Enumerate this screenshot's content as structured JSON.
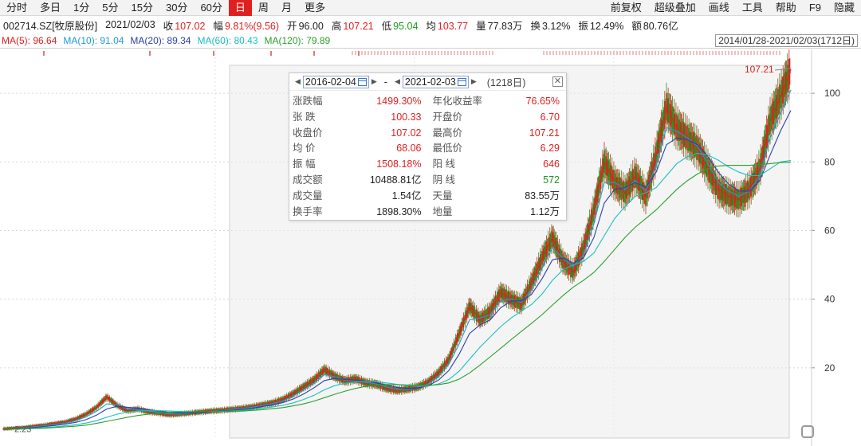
{
  "toolbar": {
    "left": [
      "分时",
      "多日",
      "1分",
      "5分",
      "15分",
      "30分",
      "60分",
      "日",
      "周",
      "月",
      "更多"
    ],
    "active_index": 7,
    "right": [
      "前复权",
      "超级叠加",
      "画线",
      "工具",
      "帮助",
      "F9",
      "隐藏"
    ]
  },
  "quote": {
    "code": "002714.SZ[牧原股份]",
    "date": "2021/02/03",
    "close_label": "收",
    "close": "107.02",
    "range_label": "幅",
    "range": "9.81%(9.56)",
    "open_label": "开",
    "open": "96.00",
    "high_label": "高",
    "high": "107.21",
    "low_label": "低",
    "low": "95.04",
    "avg_label": "均",
    "avg": "103.77",
    "vol_label": "量",
    "vol": "77.83万",
    "turnover_label": "换",
    "turnover": "3.12%",
    "amp_label": "振",
    "amp": "12.49%",
    "amount_label": "额",
    "amount": "80.76亿"
  },
  "ma": [
    {
      "label": "MA(5): 96.64",
      "color": "#e02020"
    },
    {
      "label": "MA(10): 91.04",
      "color": "#1e9bd8"
    },
    {
      "label": "MA(20): 89.34",
      "color": "#2a3fb0"
    },
    {
      "label": "MA(60): 80.43",
      "color": "#17c0c0"
    },
    {
      "label": "MA(120): 79.89",
      "color": "#2aa02a"
    }
  ],
  "range_text": "2014/01/28-2021/02/03(1712日)",
  "popup": {
    "start_date": "2016-02-04",
    "end_date": "2021-02-03",
    "days": "(1218日)",
    "rows": [
      {
        "label": "涨跌幅",
        "value": "1499.30%",
        "color": "#e02020"
      },
      {
        "label": "年化收益率",
        "value": "76.65%",
        "color": "#e02020"
      },
      {
        "label": "张 跌",
        "value": "100.33",
        "color": "#e02020"
      },
      {
        "label": "开盘价",
        "value": "6.70",
        "color": "#e02020"
      },
      {
        "label": "收盘价",
        "value": "107.02",
        "color": "#e02020"
      },
      {
        "label": "最高价",
        "value": "107.21",
        "color": "#e02020"
      },
      {
        "label": "均 价",
        "value": "68.06",
        "color": "#e02020"
      },
      {
        "label": "最低价",
        "value": "6.29",
        "color": "#e02020"
      },
      {
        "label": "振 幅",
        "value": "1508.18%",
        "color": "#e02020"
      },
      {
        "label": "阳 线",
        "value": "646",
        "color": "#e02020"
      },
      {
        "label": "成交额",
        "value": "10488.81亿",
        "color": "#222222"
      },
      {
        "label": "阴 线",
        "value": "572",
        "color": "#1a9a1a"
      },
      {
        "label": "成交量",
        "value": "1.54亿",
        "color": "#222222"
      },
      {
        "label": "天量",
        "value": "83.55万",
        "color": "#222222"
      },
      {
        "label": "换手率",
        "value": "1898.30%",
        "color": "#222222"
      },
      {
        "label": "地量",
        "value": "1.12万",
        "color": "#222222"
      }
    ]
  },
  "chart_data": {
    "type": "line",
    "y_ticks": [
      20,
      40,
      60,
      80,
      100
    ],
    "ylim": [
      0,
      110
    ],
    "max_label": "107.21",
    "min_label": "2.23",
    "series": [
      {
        "values": [
          2.2,
          2.4,
          2.6,
          3.0,
          3.3,
          3.8,
          4.2,
          5.1,
          6.5,
          8.5,
          11.5,
          9.0,
          7.5,
          8.0,
          7.2,
          6.8,
          6.3,
          6.5,
          6.8,
          7.1,
          7.4,
          7.6,
          7.9,
          8.2,
          8.6,
          9.2,
          9.8,
          10.8,
          12.5,
          14.5,
          16.5,
          19.5,
          17.5,
          16.2,
          16.8,
          15.6,
          15.2,
          14.0,
          13.4,
          13.8,
          14.4,
          15.8,
          18.5,
          22.5,
          30.0,
          38.0,
          34.0,
          36.5,
          42.0,
          40.0,
          38.5,
          45.0,
          52.0,
          58.0,
          51.0,
          48.0,
          55.0,
          66.0,
          80.0,
          74.0,
          71.0,
          76.0,
          70.0,
          82.0,
          96.0,
          90.0,
          87.0,
          84.0,
          78.0,
          72.0,
          70.0,
          69.0,
          72.0,
          78.0,
          92.0,
          99.0,
          107.0
        ]
      },
      {
        "values": [
          2.2,
          2.3,
          2.5,
          2.8,
          3.1,
          3.5,
          3.9,
          4.6,
          5.7,
          7.3,
          9.5,
          9.2,
          8.1,
          7.9,
          7.4,
          7.0,
          6.6,
          6.5,
          6.7,
          7.0,
          7.3,
          7.5,
          7.8,
          8.1,
          8.5,
          9.0,
          9.6,
          10.4,
          11.8,
          13.6,
          15.5,
          18.0,
          17.4,
          16.4,
          16.4,
          15.8,
          15.3,
          14.4,
          13.7,
          13.7,
          14.2,
          15.3,
          17.5,
          21.0,
          27.0,
          34.0,
          34.5,
          35.5,
          39.5,
          40.0,
          39.0,
          43.0,
          49.0,
          55.0,
          52.0,
          49.5,
          53.0,
          62.0,
          74.0,
          74.0,
          72.0,
          74.5,
          71.5,
          79.0,
          90.0,
          89.0,
          87.0,
          84.5,
          79.5,
          74.0,
          71.5,
          70.0,
          71.5,
          76.0,
          87.0,
          94.0,
          101.0
        ]
      },
      {
        "values": [
          2.2,
          2.3,
          2.4,
          2.6,
          2.9,
          3.2,
          3.6,
          4.1,
          4.9,
          6.2,
          8.0,
          8.8,
          8.5,
          8.2,
          7.8,
          7.4,
          7.0,
          6.8,
          6.8,
          6.9,
          7.1,
          7.4,
          7.6,
          7.9,
          8.2,
          8.7,
          9.2,
          9.9,
          10.9,
          12.4,
          14.2,
          16.3,
          16.9,
          16.6,
          16.4,
          16.1,
          15.6,
          15.0,
          14.3,
          14.0,
          14.1,
          14.8,
          16.4,
          19.2,
          24.0,
          30.0,
          32.5,
          34.0,
          37.5,
          39.5,
          39.5,
          41.5,
          46.0,
          51.5,
          52.0,
          50.5,
          52.0,
          58.0,
          68.0,
          72.0,
          72.5,
          74.0,
          72.5,
          77.0,
          85.0,
          87.0,
          86.5,
          85.0,
          81.5,
          77.0,
          73.5,
          71.5,
          71.5,
          74.5,
          82.0,
          89.0,
          95.0
        ]
      },
      {
        "values": [
          2.2,
          2.2,
          2.3,
          2.4,
          2.6,
          2.8,
          3.1,
          3.4,
          3.9,
          4.6,
          5.6,
          6.5,
          7.1,
          7.4,
          7.5,
          7.5,
          7.4,
          7.3,
          7.2,
          7.2,
          7.2,
          7.3,
          7.4,
          7.6,
          7.9,
          8.2,
          8.6,
          9.1,
          9.8,
          10.8,
          12.0,
          13.6,
          14.8,
          15.5,
          15.9,
          16.0,
          15.9,
          15.6,
          15.2,
          14.8,
          14.6,
          14.7,
          15.3,
          16.6,
          19.0,
          22.5,
          26.0,
          29.0,
          32.0,
          34.5,
          36.5,
          38.5,
          41.5,
          45.5,
          48.5,
          50.0,
          51.0,
          53.5,
          58.5,
          63.5,
          67.0,
          70.0,
          71.0,
          72.5,
          76.0,
          79.5,
          81.5,
          82.5,
          82.0,
          80.5,
          78.5,
          77.0,
          76.0,
          76.0,
          78.0,
          80.0,
          80.4
        ]
      },
      {
        "values": [
          2.2,
          2.2,
          2.2,
          2.3,
          2.4,
          2.6,
          2.8,
          3.0,
          3.3,
          3.8,
          4.4,
          5.0,
          5.6,
          6.1,
          6.5,
          6.8,
          7.0,
          7.1,
          7.1,
          7.2,
          7.2,
          7.2,
          7.3,
          7.4,
          7.6,
          7.8,
          8.1,
          8.4,
          8.9,
          9.5,
          10.3,
          11.3,
          12.3,
          13.2,
          14.0,
          14.6,
          15.0,
          15.1,
          15.1,
          15.0,
          14.9,
          14.9,
          15.1,
          15.6,
          16.7,
          18.5,
          20.8,
          23.2,
          25.7,
          28.2,
          30.6,
          33.0,
          35.5,
          38.3,
          41.0,
          43.5,
          45.5,
          47.8,
          51.0,
          54.5,
          58.0,
          61.0,
          63.5,
          66.0,
          69.0,
          72.0,
          74.5,
          76.5,
          78.0,
          78.8,
          79.0,
          79.0,
          79.0,
          79.2,
          79.5,
          79.8,
          79.9
        ]
      }
    ]
  }
}
